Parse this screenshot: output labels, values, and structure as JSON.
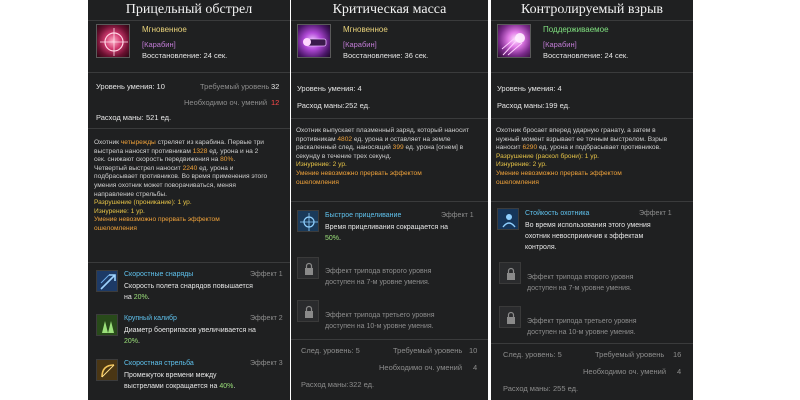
{
  "panels": [
    {
      "title": "Прицельный обстрел",
      "cast_type": "Мгновенное",
      "weapon": "[Карабин]",
      "cooldown": "Восстановление: 24 сек.",
      "skill_level_label": "Уровень умения: 10",
      "required_level_label": "Требуемый уровень",
      "required_level_value": "32",
      "points_label": "Необходимо оч. умений",
      "points_value": "12",
      "mana_label": "Расход маны:",
      "mana_value": "521 ед.",
      "description_lines": [
        [
          "Охотник ",
          "четырежды",
          " стреляет из карабина. Первые три"
        ],
        [
          "выстрела наносят противникам ",
          "1328",
          " ед. урона и на 2"
        ],
        [
          "сек. снижают скорость передвижения на ",
          "80%",
          "."
        ],
        [
          "Четвертый выстрел наносит ",
          "2240",
          " ед. урона и"
        ],
        [
          "подбрасывает противников. Во время применения этого"
        ],
        [
          "умения охотник может поворачиваться, меняя"
        ],
        [
          "направление стрельбы."
        ]
      ],
      "effects": [
        "Разрушение (проникание): 1 ур.",
        "Изнурение: 1 ур."
      ],
      "note_lines": [
        "Умение невозможно прервать эффектом",
        "ошеломления"
      ],
      "tripods": [
        {
          "name": "Скоростные снаряды",
          "effect": "Эффект 1",
          "desc1": "Скорость полета снарядов повышается",
          "desc2_pre": "на ",
          "desc2_val": "20%",
          "desc2_post": "."
        },
        {
          "name": "Крупный калибр",
          "effect": "Эффект 2",
          "desc1": "Диаметр боеприпасов увеличивается на",
          "desc2_pre": "",
          "desc2_val": "20%",
          "desc2_post": "."
        },
        {
          "name": "Скоростная стрельба",
          "effect": "Эффект 3",
          "desc1": "Промежуток времени между",
          "desc2_pre": "выстрелами сокращается на ",
          "desc2_val": "40%",
          "desc2_post": "."
        }
      ]
    },
    {
      "title": "Критическая масса",
      "cast_type": "Мгновенное",
      "weapon": "[Карабин]",
      "cooldown": "Восстановление: 36 сек.",
      "skill_level_label": "Уровень умения: 4",
      "mana_label": "Расход маны:",
      "mana_value": "252 ед.",
      "description_lines": [
        [
          "Охотник выпускает плазменный заряд, который наносит"
        ],
        [
          "противникам ",
          "4802",
          " ед. урона и оставляет на земле"
        ],
        [
          "раскаленный след, наносящий ",
          "399",
          " ед. урона [огнем] в"
        ],
        [
          "секунду в течение трех секунд."
        ]
      ],
      "effects": [
        "Изнурение: 2 ур."
      ],
      "note_lines": [
        "Умение невозможно прервать эффектом",
        "ошеломления"
      ],
      "tripod": {
        "name": "Быстрое прицеливание",
        "effect": "Эффект 1",
        "desc1": "Время прицеливания сокращается на",
        "desc2_val": "50%",
        "desc2_post": "."
      },
      "locked": [
        {
          "line1": "Эффект трипода второго уровня",
          "line2": "доступен на 7-м уровне умения."
        },
        {
          "line1": "Эффект трипода третьего уровня",
          "line2": "доступен на 10-м уровне умения."
        }
      ],
      "next_level_label": "След. уровень: 5",
      "required_level_label": "Требуемый уровень",
      "required_level_value": "10",
      "points_label": "Необходимо оч. умений",
      "points_value": "4",
      "next_mana_label": "Расход маны:",
      "next_mana_value": "322 ед."
    },
    {
      "title": "Контролируемый взрыв",
      "cast_type": "Поддерживаемое",
      "weapon": "[Карабин]",
      "cooldown": "Восстановление: 24 сек.",
      "skill_level_label": "Уровень умения: 4",
      "mana_label": "Расход маны:",
      "mana_value": "199 ед.",
      "description_lines": [
        [
          "Охотник бросает вперед ударную гранату, а затем в"
        ],
        [
          "нужный момент взрывает ее точным выстрелом. Взрыв"
        ],
        [
          "наносит ",
          "6290",
          " ед. урона и подбрасывает противников."
        ]
      ],
      "effects": [
        "Разрушение (раскол брони): 1 ур.",
        "Изнурение: 2 ур."
      ],
      "note_lines": [
        "Умение невозможно прервать эффектом",
        "ошеломления"
      ],
      "tripod": {
        "name": "Стойкость охотника",
        "effect": "Эффект 1",
        "desc1": "Во время использования этого умения",
        "desc2": "охотник невосприимчив к эффектам",
        "desc3": "контроля."
      },
      "locked": [
        {
          "line1": "Эффект трипода второго уровня",
          "line2": "доступен на 7-м уровне умения."
        },
        {
          "line1": "Эффект трипода третьего уровня",
          "line2": "доступен на 10-м уровне умения."
        }
      ],
      "next_level_label": "След. уровень: 5",
      "required_level_label": "Требуемый уровень",
      "required_level_value": "16",
      "points_label": "Необходимо оч. умений",
      "points_value": "4",
      "next_mana_label": "Расход маны:",
      "next_mana_value": "255 ед."
    }
  ],
  "icons": {
    "skill1": "crosshair-burst-icon",
    "skill2": "plasma-cannon-icon",
    "skill3": "explosion-icon",
    "tripod_fast": "arrows-icon",
    "tripod_caliber": "bullets-icon",
    "tripod_rapid": "bow-shot-icon",
    "tripod_aim": "aim-icon",
    "tripod_stamina": "stamina-icon",
    "lock": "lock-icon"
  },
  "colors": {
    "panel_bg": "#1f2021",
    "cast_instant": "#e8d27a",
    "cast_hold": "#7fe07f",
    "weapon": "#c27cd6",
    "tripod_name": "#5fc2ee",
    "warning_value": "#ff4a4a",
    "highlight": "#f0a23a",
    "effect_yellow": "#e6c347",
    "percent_green": "#9be07a"
  }
}
